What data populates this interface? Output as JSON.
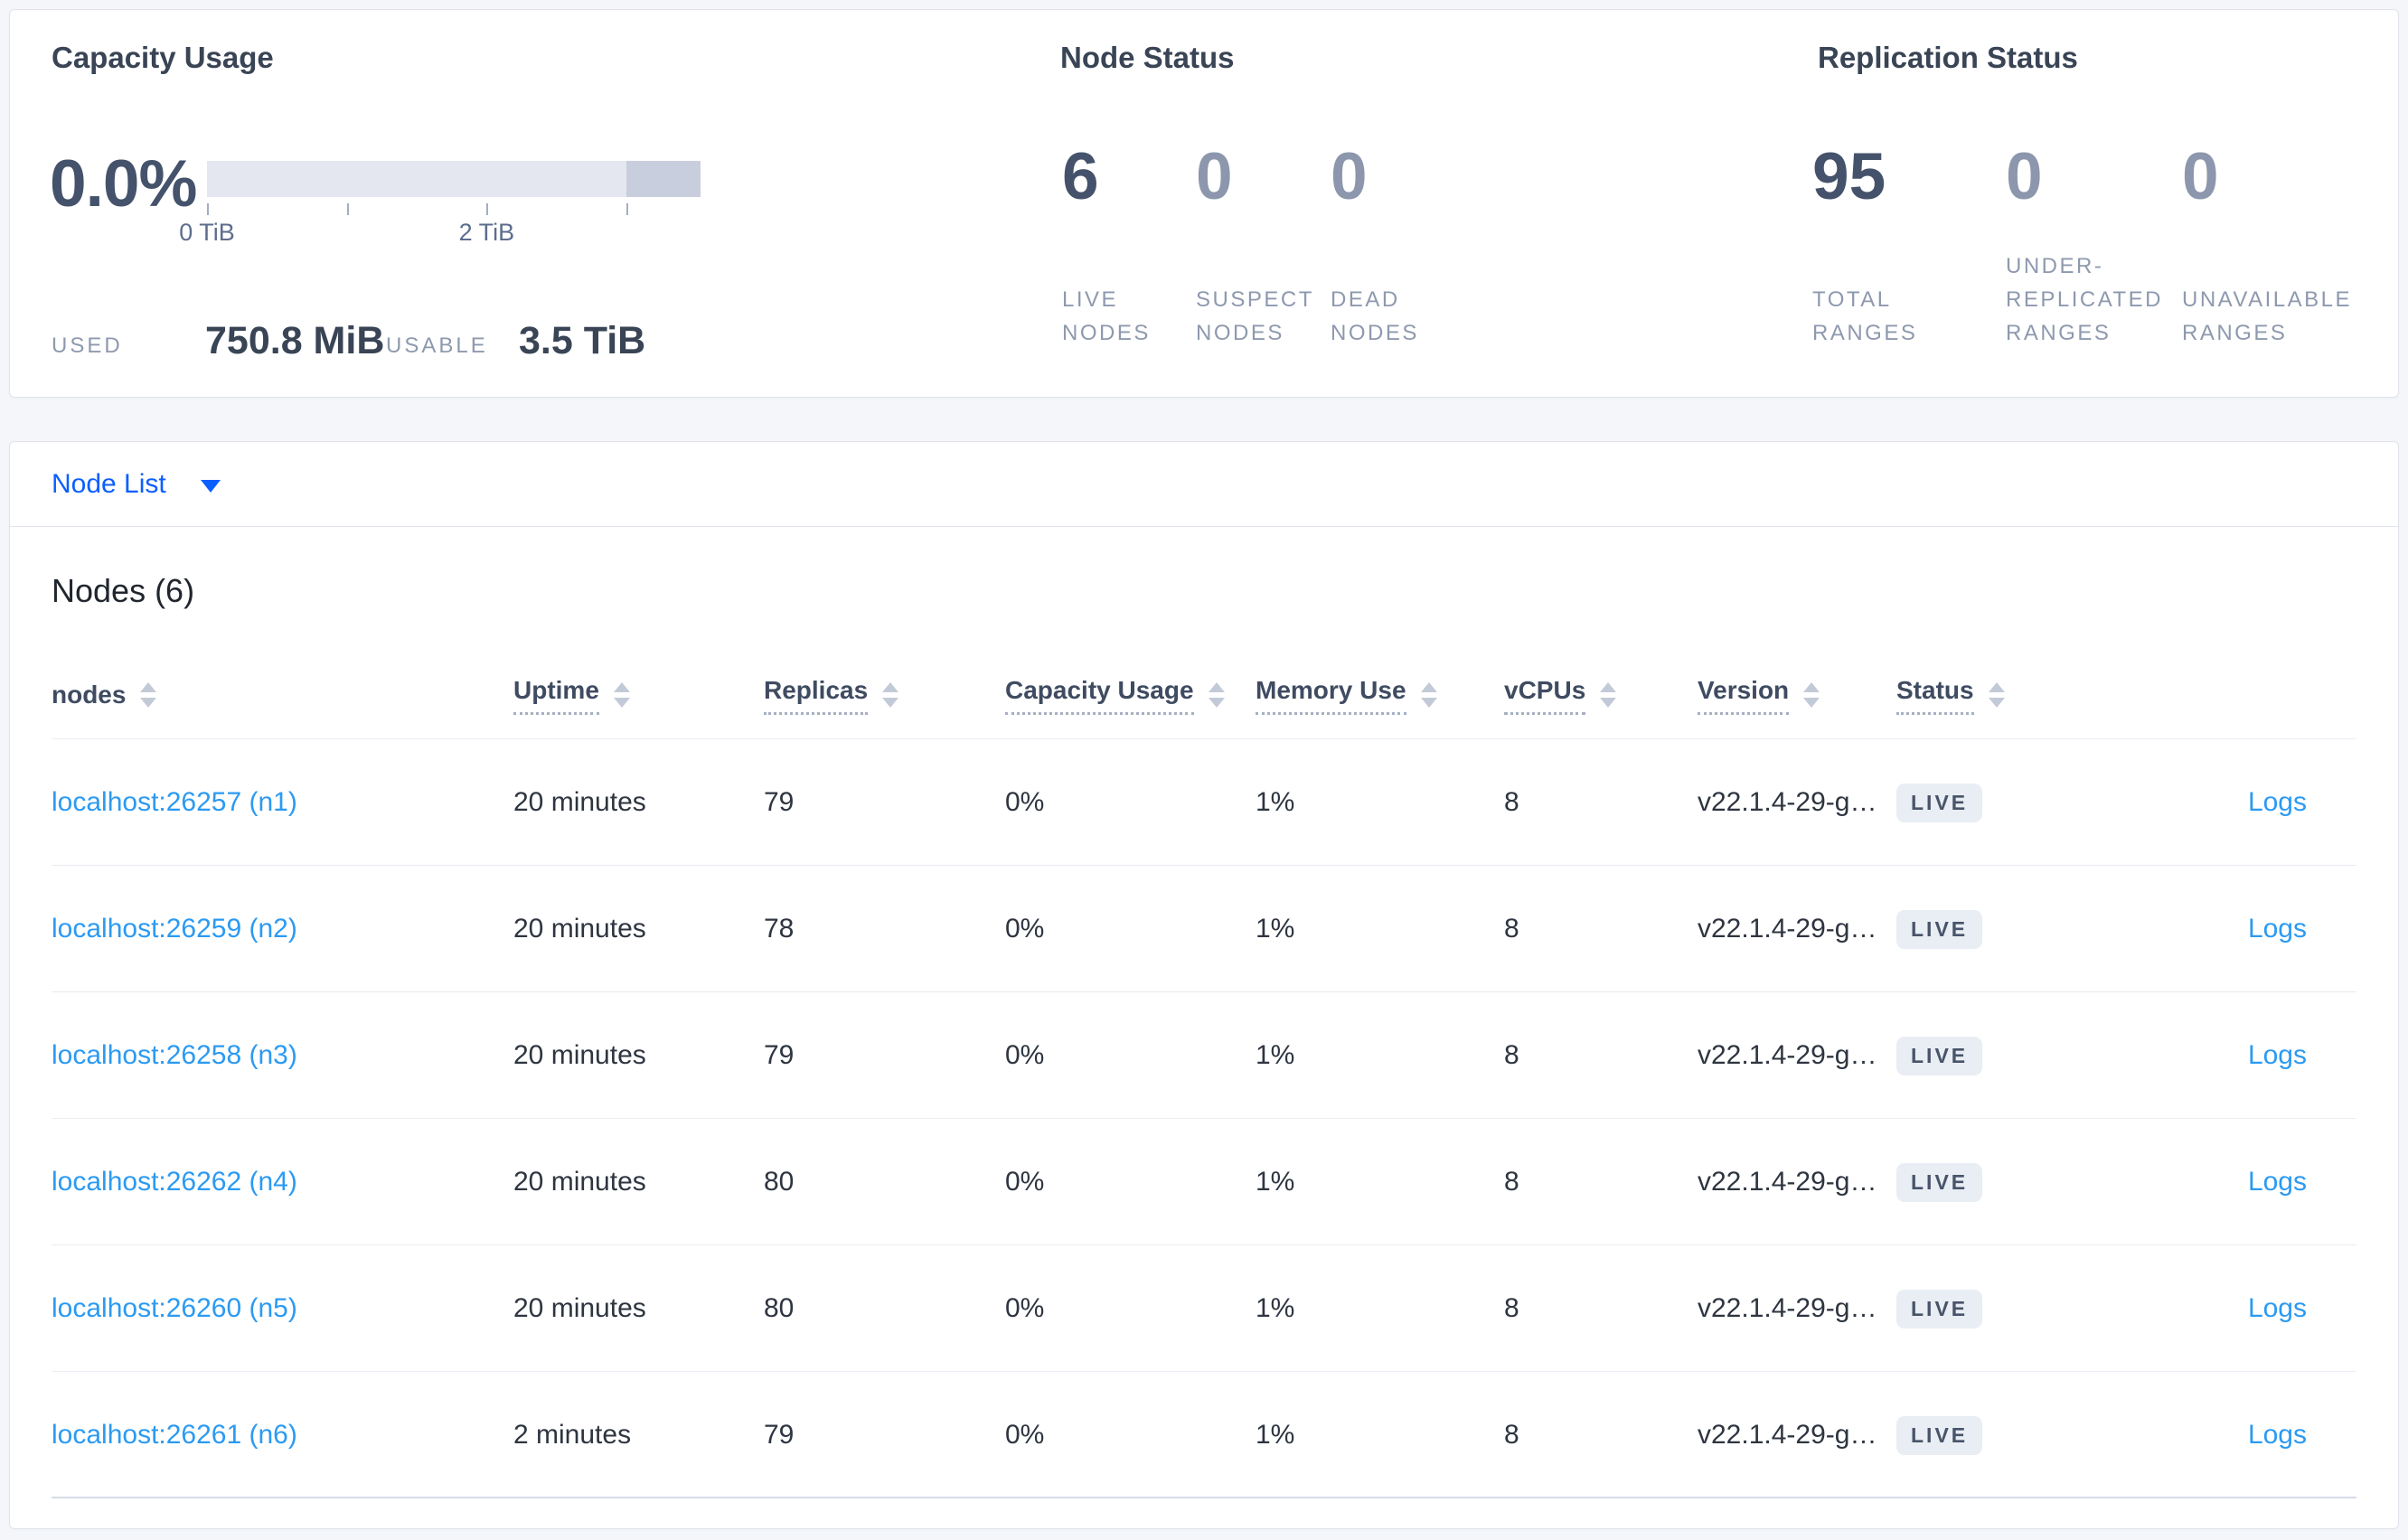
{
  "colors": {
    "brand_blue": "#0b5eff",
    "link_blue": "#2b9af2",
    "dark_slate": "#394455",
    "muted_slate": "#8e99ae",
    "badge_bg": "#e9edf4",
    "badge_text": "#475469",
    "gauge_light": "#e4e7ef",
    "gauge_dark": "#c9cede"
  },
  "summary": {
    "capacity": {
      "title": "Capacity Usage",
      "percent": "0.0%",
      "gauge": {
        "max_tib": 3.53,
        "dark_from_tib": 3.0,
        "ticks": [
          {
            "tib": 0,
            "label": "0 TiB"
          },
          {
            "tib": 1
          },
          {
            "tib": 2,
            "label": "2 TiB"
          },
          {
            "tib": 3
          }
        ]
      },
      "used_label": "USED",
      "used_value": "750.8 MiB",
      "usable_label": "USABLE",
      "usable_value": "3.5 TiB"
    },
    "node_status": {
      "title": "Node Status",
      "stats": [
        {
          "value": "6",
          "label": "LIVE NODES",
          "emph": true
        },
        {
          "value": "0",
          "label": "SUSPECT NODES",
          "emph": false
        },
        {
          "value": "0",
          "label": "DEAD NODES",
          "emph": false
        }
      ]
    },
    "replication": {
      "title": "Replication Status",
      "stats": [
        {
          "value": "95",
          "label": "TOTAL RANGES",
          "emph": true
        },
        {
          "value": "0",
          "label": "UNDER-REPLICATED RANGES",
          "emph": false
        },
        {
          "value": "0",
          "label": "UNAVAILABLE RANGES",
          "emph": false
        }
      ]
    }
  },
  "node_list": {
    "dropdown_label": "Node List"
  },
  "nodes_section": {
    "title": "Nodes (6)",
    "columns": [
      {
        "label": "nodes",
        "tooltip": false
      },
      {
        "label": "Uptime",
        "tooltip": true
      },
      {
        "label": "Replicas",
        "tooltip": true
      },
      {
        "label": "Capacity Usage",
        "tooltip": true
      },
      {
        "label": "Memory Use",
        "tooltip": true
      },
      {
        "label": "vCPUs",
        "tooltip": true
      },
      {
        "label": "Version",
        "tooltip": true
      },
      {
        "label": "Status",
        "tooltip": true
      },
      {
        "label": "",
        "tooltip": false
      }
    ],
    "rows": [
      {
        "name": "localhost:26257 (n1)",
        "uptime": "20 minutes",
        "replicas": "79",
        "capacity": "0%",
        "memory": "1%",
        "vcpus": "8",
        "version": "v22.1.4-29-g…",
        "status": "LIVE",
        "logs": "Logs"
      },
      {
        "name": "localhost:26259 (n2)",
        "uptime": "20 minutes",
        "replicas": "78",
        "capacity": "0%",
        "memory": "1%",
        "vcpus": "8",
        "version": "v22.1.4-29-g…",
        "status": "LIVE",
        "logs": "Logs"
      },
      {
        "name": "localhost:26258 (n3)",
        "uptime": "20 minutes",
        "replicas": "79",
        "capacity": "0%",
        "memory": "1%",
        "vcpus": "8",
        "version": "v22.1.4-29-g…",
        "status": "LIVE",
        "logs": "Logs"
      },
      {
        "name": "localhost:26262 (n4)",
        "uptime": "20 minutes",
        "replicas": "80",
        "capacity": "0%",
        "memory": "1%",
        "vcpus": "8",
        "version": "v22.1.4-29-g…",
        "status": "LIVE",
        "logs": "Logs"
      },
      {
        "name": "localhost:26260 (n5)",
        "uptime": "20 minutes",
        "replicas": "80",
        "capacity": "0%",
        "memory": "1%",
        "vcpus": "8",
        "version": "v22.1.4-29-g…",
        "status": "LIVE",
        "logs": "Logs"
      },
      {
        "name": "localhost:26261 (n6)",
        "uptime": "2 minutes",
        "replicas": "79",
        "capacity": "0%",
        "memory": "1%",
        "vcpus": "8",
        "version": "v22.1.4-29-g…",
        "status": "LIVE",
        "logs": "Logs"
      }
    ]
  }
}
